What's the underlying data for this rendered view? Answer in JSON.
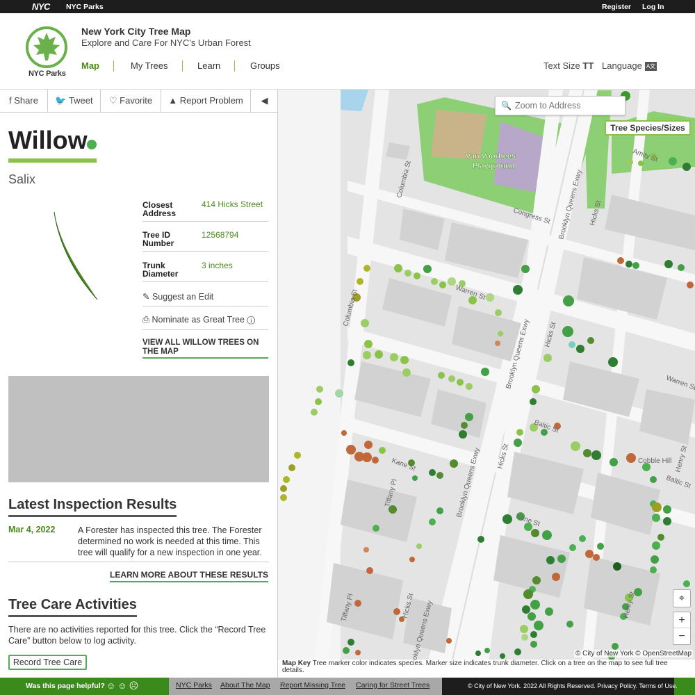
{
  "topbar": {
    "logo": "NYC",
    "brand": "NYC Parks",
    "register": "Register",
    "login": "Log In"
  },
  "header": {
    "logo_label": "NYC Parks",
    "title": "New York City Tree Map",
    "subtitle": "Explore and Care For NYC's Urban Forest",
    "nav": [
      "Map",
      "My Trees",
      "Learn",
      "Groups"
    ],
    "text_size": "Text Size",
    "language": "Language",
    "text_size_icon": "TT",
    "language_icon": "A文"
  },
  "sharebar": {
    "share": "Share",
    "tweet": "Tweet",
    "favorite": "Favorite",
    "report": "Report Problem"
  },
  "tree": {
    "name": "Willow",
    "scientific": "Salix",
    "info": [
      {
        "label": "Closest Address",
        "value": "414 Hicks Street"
      },
      {
        "label": "Tree ID Number",
        "value": "12568794"
      },
      {
        "label": "Trunk Diameter",
        "value": "3 inches"
      }
    ],
    "suggest_edit": "Suggest an Edit",
    "nominate": "Nominate as Great Tree",
    "view_all": "VIEW ALL WILLOW TREES ON THE MAP"
  },
  "inspection": {
    "heading": "Latest Inspection Results",
    "date": "Mar 4, 2022",
    "text": "A Forester has inspected this tree. The Forester determined no work is needed at this time. This tree will qualify for a new inspection in one year.",
    "learn_more": "LEARN MORE ABOUT THESE RESULTS"
  },
  "care": {
    "heading": "Tree Care Activities",
    "text": "There are no activities reported for this tree. Click the “Record Tree Care” button below to log activity.",
    "button": "Record Tree Care"
  },
  "map": {
    "search_placeholder": "Zoom to Address",
    "species_button": "Tree Species/Sizes",
    "attribution": "© City of New York © OpenStreetMap",
    "playground": [
      "Van Voorhees",
      "Playground"
    ],
    "labels": [
      "Amity St",
      "Congress St",
      "Columbia St",
      "Warren St",
      "Brooklyn Queens Exwy",
      "Hicks St",
      "Baltic St",
      "Kane St",
      "Tiffany Pl",
      "Cobble Hill",
      "Henry St"
    ],
    "key_title": "Map Key",
    "key_text": "Tree marker color indicates species. Marker size indicates trunk diameter. Click on a tree on the map to see full tree details."
  },
  "footer": {
    "helpful": "Was this page helpful?",
    "links": [
      "NYC Parks",
      "About The Map",
      "Report Missing Tree",
      "Caring for Street Trees"
    ],
    "copyright": "© City of New York. 2022 All Rights Reserved. Privacy Policy. Terms of Use."
  }
}
